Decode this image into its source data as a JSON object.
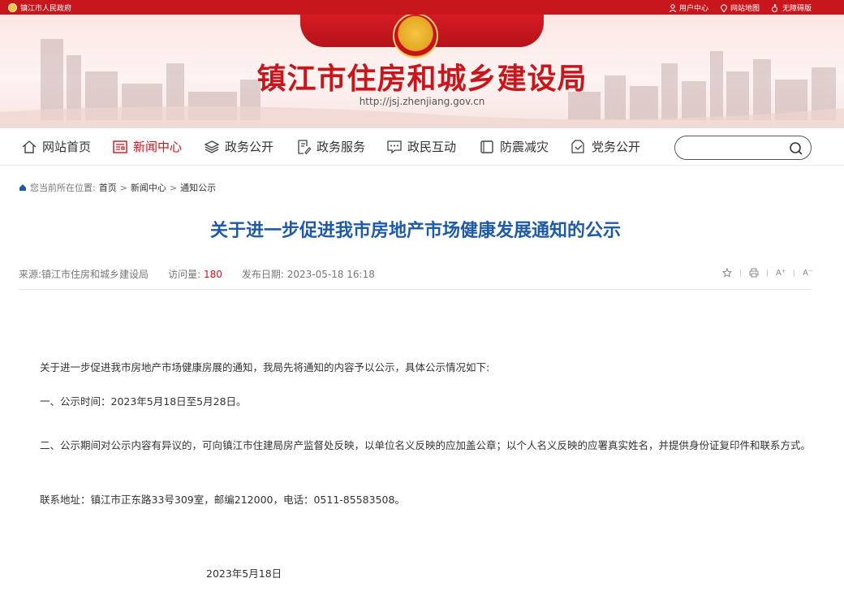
{
  "topbar": {
    "gov_link": "镇江市人民政府",
    "user_center": "用户中心",
    "sitemap": "网站地图",
    "accessibility": "无障碍版"
  },
  "banner": {
    "title": "镇江市住房和城乡建设局",
    "url": "http://jsj.zhenjiang.gov.cn"
  },
  "nav": {
    "items": [
      {
        "label": "网站首页",
        "icon": "home-icon"
      },
      {
        "label": "新闻中心",
        "icon": "newspaper-icon"
      },
      {
        "label": "政务公开",
        "icon": "layers-icon"
      },
      {
        "label": "政务服务",
        "icon": "document-pen-icon"
      },
      {
        "label": "政民互动",
        "icon": "chat-icon"
      },
      {
        "label": "防震减灾",
        "icon": "frame-icon"
      },
      {
        "label": "党务公开",
        "icon": "folder-icon"
      }
    ],
    "active_index": 1,
    "search_placeholder": ""
  },
  "breadcrumb": {
    "prefix": "您当前所在位置:",
    "items": [
      "首页",
      "新闻中心",
      "通知公示"
    ],
    "separator": ">"
  },
  "article": {
    "title": "关于进一步促进我市房地产市场健康发展通知的公示",
    "source_label": "来源:",
    "source": "镇江市住房和城乡建设局",
    "views_label": "访问量:",
    "views": "180",
    "date_label": "发布日期:",
    "date": "2023-05-18 16:18",
    "paragraphs": [
      "关于进一步促进我市房地产市场健康房展的通知，我局先将通知的内容予以公示，具体公示情况如下:",
      "一、公示时间：2023年5月18日至5月28日。",
      "二、公示期间对公示内容有异议的，可向镇江市住建局房产监督处反映，以单位名义反映的应加盖公章；以个人名义反映的应署真实姓名，并提供身份证复印件和联系方式。",
      "联系地址：镇江市正东路33号309室，邮编212000，电话：0511-85583508。"
    ],
    "sign_date": "2023年5月18日"
  },
  "tools": {
    "font_up": "A⁺",
    "font_down": "A⁻"
  },
  "colors": {
    "brand_red": "#c8161d",
    "title_blue": "#1f5aa6"
  }
}
